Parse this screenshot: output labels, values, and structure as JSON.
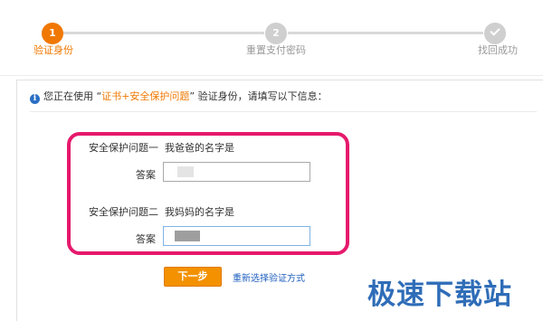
{
  "steps": [
    {
      "number": "1",
      "label": "验证身份",
      "state": "active"
    },
    {
      "number": "2",
      "label": "重置支付密码",
      "state": "pending"
    },
    {
      "number": "",
      "label": "找回成功",
      "state": "done-icon"
    }
  ],
  "notice": {
    "prefix": "您正在使用 “",
    "method": "证书+安全保护问题",
    "suffix": "” 验证身份，请填写以下信息："
  },
  "form": {
    "question1": {
      "label": "安全保护问题一",
      "text": "我爸爸的名字是",
      "answer_label": "答案"
    },
    "question2": {
      "label": "安全保护问题二",
      "text": "我妈妈的名字是",
      "answer_label": "答案"
    }
  },
  "actions": {
    "next_label": "下一步",
    "reselect_label": "重新选择验证方式"
  },
  "watermark": "极速下载站",
  "colors": {
    "accent": "#f07800",
    "button": "#f39100",
    "highlight_border": "#e6196c",
    "link": "#1f5fbf",
    "info_icon": "#2a6fc4"
  }
}
